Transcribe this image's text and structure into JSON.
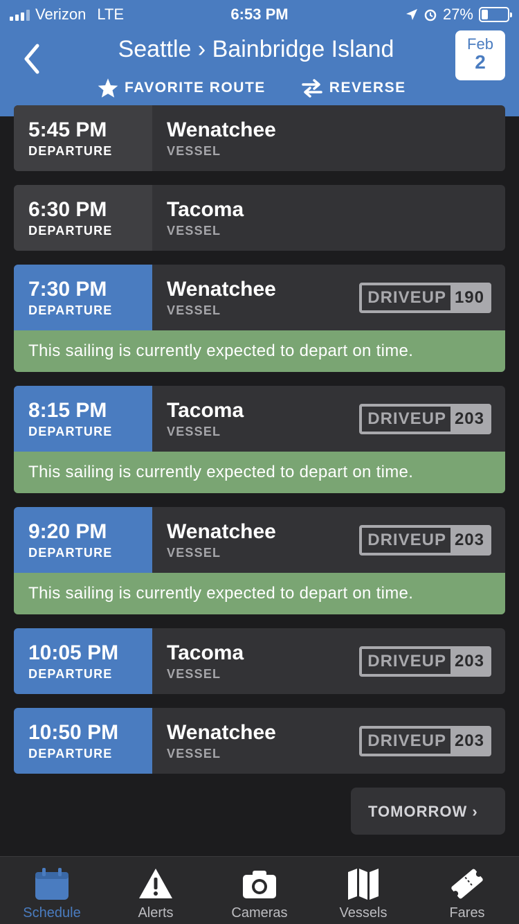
{
  "status_bar": {
    "carrier": "Verizon",
    "network": "LTE",
    "time": "6:53 PM",
    "battery": "27%"
  },
  "header": {
    "route_title": "Seattle › Bainbridge Island",
    "favorite_label": "FAVORITE ROUTE",
    "reverse_label": "REVERSE",
    "date_month": "Feb",
    "date_day": "2"
  },
  "labels": {
    "departure": "DEPARTURE",
    "vessel": "VESSEL",
    "driveup": "DRIVEUP"
  },
  "sailings": [
    {
      "time": "5:45 PM",
      "vessel": "Wenatchee"
    },
    {
      "time": "6:30 PM",
      "vessel": "Tacoma"
    },
    {
      "time": "7:30 PM",
      "vessel": "Wenatchee",
      "driveup": "190",
      "status": "This sailing is currently expected to depart on time."
    },
    {
      "time": "8:15 PM",
      "vessel": "Tacoma",
      "driveup": "203",
      "status": "This sailing is currently expected to depart on time."
    },
    {
      "time": "9:20 PM",
      "vessel": "Wenatchee",
      "driveup": "203",
      "status": "This sailing is currently expected to depart on time."
    },
    {
      "time": "10:05 PM",
      "vessel": "Tacoma",
      "driveup": "203"
    },
    {
      "time": "10:50 PM",
      "vessel": "Wenatchee",
      "driveup": "203"
    }
  ],
  "tomorrow_label": "TOMORROW ›",
  "tabs": [
    {
      "label": "Schedule",
      "icon": "calendar-icon",
      "active": true
    },
    {
      "label": "Alerts",
      "icon": "warning-icon"
    },
    {
      "label": "Cameras",
      "icon": "camera-icon"
    },
    {
      "label": "Vessels",
      "icon": "map-icon"
    },
    {
      "label": "Fares",
      "icon": "ticket-icon"
    }
  ],
  "colors": {
    "header": "#4a7cc0",
    "on_time": "#7aa573",
    "background": "#1c1c1e",
    "card": "#333336"
  }
}
